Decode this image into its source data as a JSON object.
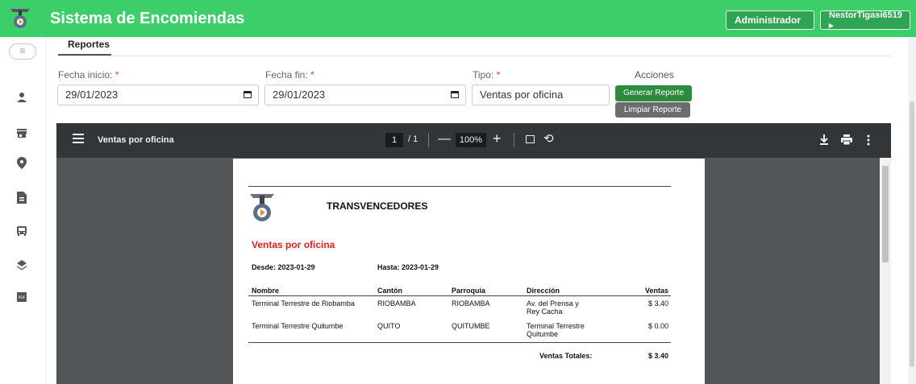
{
  "header": {
    "app_title": "Sistema de Encomiendas",
    "role_button": "Administrador",
    "user_button": "NestorTigasi6519 ▸"
  },
  "sidebar": {
    "toggle_icon": "≡",
    "items": [
      {
        "icon": "person-icon"
      },
      {
        "icon": "store-icon"
      },
      {
        "icon": "location-pin-icon"
      },
      {
        "icon": "document-icon"
      },
      {
        "icon": "bus-icon"
      },
      {
        "icon": "layers-icon"
      },
      {
        "icon": "pdf-icon"
      }
    ]
  },
  "tabs": {
    "active": "Reportes"
  },
  "form": {
    "fecha_inicio": {
      "label": "Fecha inicio:",
      "required_mark": "*",
      "value": "29/01/2023"
    },
    "fecha_fin": {
      "label": "Fecha fin:",
      "required_mark": "*",
      "value": "29/01/2023"
    },
    "tipo": {
      "label": "Tipo:",
      "required_mark": "*",
      "value": "Ventas por oficina"
    },
    "acciones_label": "Acciones",
    "generate_button": "Generar Reporte",
    "clear_button": "Limpiar Reporte"
  },
  "viewer": {
    "doc_title": "Ventas por oficina",
    "current_page": "1",
    "page_total": "/ 1",
    "zoom": "100%",
    "minus": "—",
    "plus": "+",
    "rotate": "⟲"
  },
  "report": {
    "company": "TRANSVENCEDORES",
    "title": "Ventas por oficina",
    "desde": "Desde: 2023-01-29",
    "hasta": "Hasta: 2023-01-29",
    "columns": {
      "nombre": "Nombre",
      "canton": "Cantón",
      "parroquia": "Parroquia",
      "direccion": "Dirección",
      "ventas": "Ventas"
    },
    "rows": [
      {
        "nombre": "Terminal Terrestre de Riobamba",
        "canton": "RIOBAMBA",
        "parroquia": "RIOBAMBA",
        "direccion_1": "Av. del Prensa y",
        "direccion_2": "Rey Cacha",
        "ventas": "$ 3.40"
      },
      {
        "nombre": "Terminal Terrestre Quitumbe",
        "canton": "QUITO",
        "parroquia": "QUITUMBE",
        "direccion_1": "Terminal Terrestre",
        "direccion_2": "Quitumbe",
        "ventas": "$ 0.00"
      }
    ],
    "total_label": "Ventas Totales:",
    "total_value": "$ 3.40"
  },
  "colors": {
    "header_green": "#3ccf69",
    "generate_green": "#2e8b3e",
    "clear_gray": "#6c6c6c",
    "report_title_red": "#e41e1e"
  }
}
